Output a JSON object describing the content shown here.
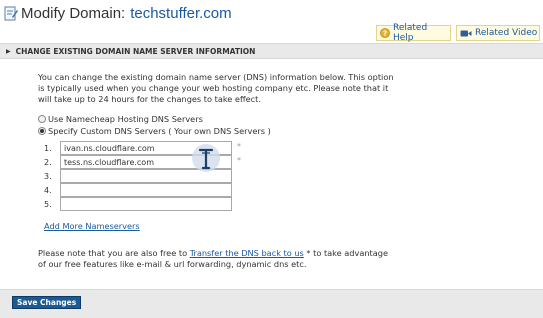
{
  "header": {
    "title_prefix": "Modify Domain:",
    "domain": "techstuffer.com"
  },
  "help_buttons": {
    "related_help": "Related Help",
    "related_video": "Related Video"
  },
  "section": {
    "title": "CHANGE EXISTING DOMAIN NAME SERVER INFORMATION"
  },
  "intro": {
    "text": "You can change the existing domain name server (DNS) information below. This option is typically used when you change your web hosting company etc. Please note that it will take up to 24 hours for the changes to take effect."
  },
  "options": {
    "namecheap_label": "Use Namecheap Hosting DNS Servers",
    "custom_label": "Specify Custom DNS Servers ( Your own DNS Servers )",
    "selected": "custom"
  },
  "nameservers": [
    {
      "num": "1.",
      "value": "ivan.ns.cloudflare.com",
      "required": "*"
    },
    {
      "num": "2.",
      "value": "tess.ns.cloudflare.com",
      "required": "*"
    },
    {
      "num": "3.",
      "value": "",
      "required": ""
    },
    {
      "num": "4.",
      "value": "",
      "required": ""
    },
    {
      "num": "5.",
      "value": "",
      "required": ""
    }
  ],
  "add_more": "Add More Nameservers",
  "note": {
    "before": "Please note that you are also free to ",
    "link": "Transfer the DNS back to us",
    "after": " * to take advantage of our free features like e-mail & url forwarding, dynamic dns etc."
  },
  "footer": {
    "save_label": "Save Changes"
  },
  "colors": {
    "link": "#1a5aa0",
    "save_button": "#1c5a94",
    "section_bg": "#e9e9e9"
  }
}
